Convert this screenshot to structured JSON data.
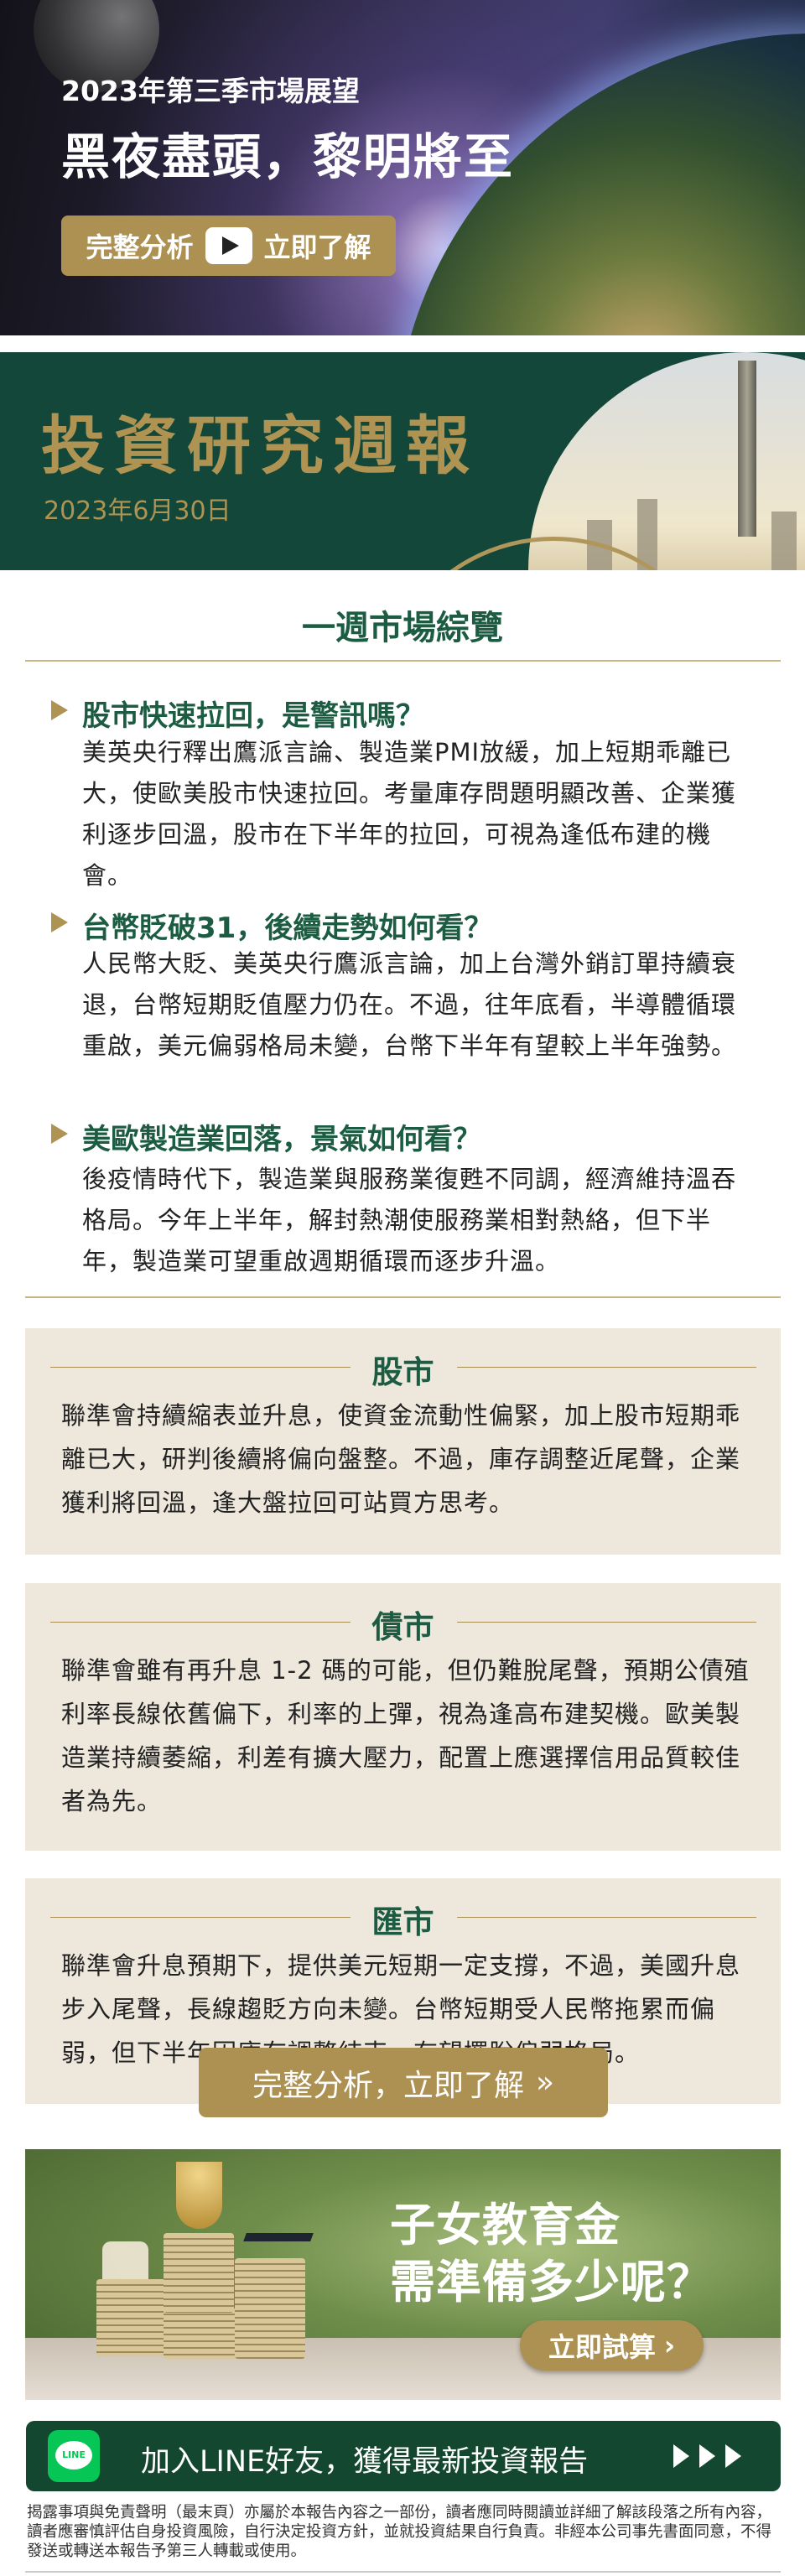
{
  "hero": {
    "subtitle": "2023年第三季市場展望",
    "title": "黑夜盡頭，黎明將至",
    "button_left": "完整分析",
    "button_right": "立即了解",
    "play_icon": "play-icon"
  },
  "banner": {
    "title": "投資研究週報",
    "date": "2023年6月30日"
  },
  "overview": {
    "title": "一週市場綜覽",
    "items": [
      {
        "heading": "股市快速拉回，是警訊嗎？",
        "body": "美英央行釋出鷹派言論、製造業PMI放緩，加上短期乖離已大，使歐美股市快速拉回。考量庫存問題明顯改善、企業獲利逐步回溫，股市在下半年的拉回，可視為逢低布建的機會。"
      },
      {
        "heading": "台幣貶破31，後續走勢如何看？",
        "body": "人民幣大貶、美英央行鷹派言論，加上台灣外銷訂單持續衰退，台幣短期貶值壓力仍在。不過，往年底看，半導體循環重啟，美元偏弱格局未變，台幣下半年有望較上半年強勢。"
      },
      {
        "heading": "美歐製造業回落，景氣如何看？",
        "body": "後疫情時代下，製造業與服務業復甦不同調，經濟維持溫吞格局。今年上半年，解封熱潮使服務業相對熱絡，但下半年，製造業可望重啟週期循環而逐步升溫。"
      }
    ]
  },
  "markets": [
    {
      "label": "股市",
      "body": "聯準會持續縮表並升息，使資金流動性偏緊，加上股市短期乖離已大，研判後續將偏向盤整。不過，庫存調整近尾聲，企業獲利將回溫，逢大盤拉回可站買方思考。"
    },
    {
      "label": "債市",
      "body": "聯準會雖有再升息 1-2 碼的可能，但仍難脫尾聲，預期公債殖利率長線依舊偏下，利率的上彈，視為逢高布建契機。歐美製造業持續萎縮，利差有擴大壓力，配置上應選擇信用品質較佳者為先。"
    },
    {
      "label": "匯市",
      "body": "聯準會升息預期下，提供美元短期一定支撐，不過，美國升息步入尾聲，長線趨貶方向未變。台幣短期受人民幣拖累而偏弱，但下半年因庫存調整結束，有望擺脫偏弱格局。"
    }
  ],
  "cta": {
    "label": "完整分析，立即了解",
    "icon": "double-chevron-right-icon"
  },
  "edu": {
    "line1": "子女教育金",
    "line2": "需準備多少呢？",
    "button": "立即試算",
    "button_icon": "chevron-right-icon"
  },
  "line": {
    "icon_text": "LINE",
    "label": "加入LINE好友，獲得最新投資報告"
  },
  "disclaimer": "揭露事項與免責聲明（最末頁）亦屬於本報告內容之一部份，讀者應同時閱讀並詳細了解該段落之所有內容，讀者應審慎評估自身投資風險，自行決定投資方針，並就投資結果自行負責。非經本公司事先書面同意，不得發送或轉送本報告予第三人轉載或使用。",
  "colors": {
    "gold": "#ad9152",
    "green": "#13472f",
    "heading_green": "#1b5c42",
    "box_bg": "#ede7dc"
  }
}
